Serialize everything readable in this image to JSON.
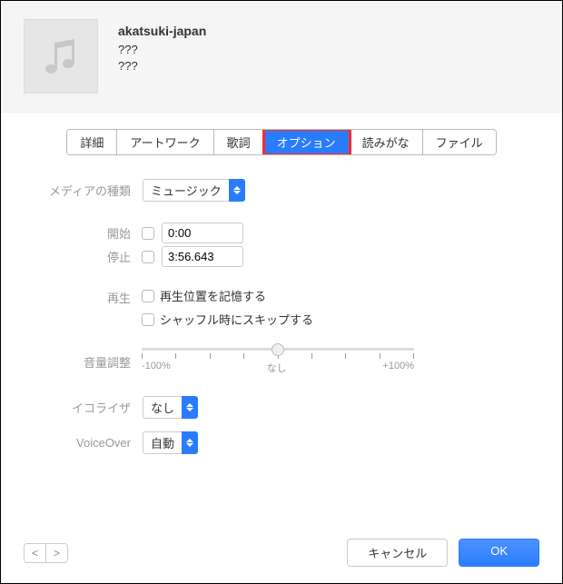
{
  "header": {
    "title": "akatsuki-japan",
    "artist": "???",
    "album": "???"
  },
  "tabs": [
    {
      "label": "詳細",
      "active": false
    },
    {
      "label": "アートワーク",
      "active": false
    },
    {
      "label": "歌詞",
      "active": false
    },
    {
      "label": "オプション",
      "active": true,
      "highlighted": true
    },
    {
      "label": "読みがな",
      "active": false
    },
    {
      "label": "ファイル",
      "active": false
    }
  ],
  "options": {
    "mediaType": {
      "label": "メディアの種類",
      "value": "ミュージック"
    },
    "start": {
      "label": "開始",
      "value": "0:00"
    },
    "stop": {
      "label": "停止",
      "value": "3:56.643"
    },
    "playback": {
      "label": "再生",
      "remember": "再生位置を記憶する",
      "skipShuffle": "シャッフル時にスキップする"
    },
    "volume": {
      "label": "音量調整",
      "min": "-100%",
      "mid": "なし",
      "max": "+100%"
    },
    "equalizer": {
      "label": "イコライザ",
      "value": "なし"
    },
    "voiceover": {
      "label": "VoiceOver",
      "value": "自動"
    }
  },
  "footer": {
    "cancel": "キャンセル",
    "ok": "OK"
  }
}
